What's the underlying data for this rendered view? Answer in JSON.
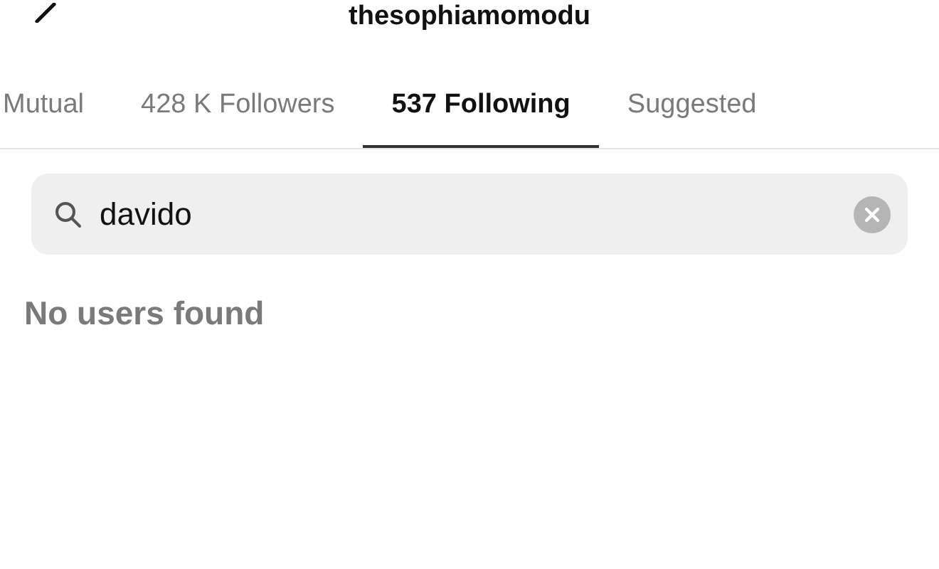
{
  "header": {
    "title": "thesophiamomodu"
  },
  "tabs": [
    {
      "label": "Mutual",
      "selected": false
    },
    {
      "label": "428 K Followers",
      "selected": false
    },
    {
      "label": "537 Following",
      "selected": true
    },
    {
      "label": "Suggested",
      "selected": false
    }
  ],
  "search": {
    "value": "davido"
  },
  "empty_message": "No users found"
}
